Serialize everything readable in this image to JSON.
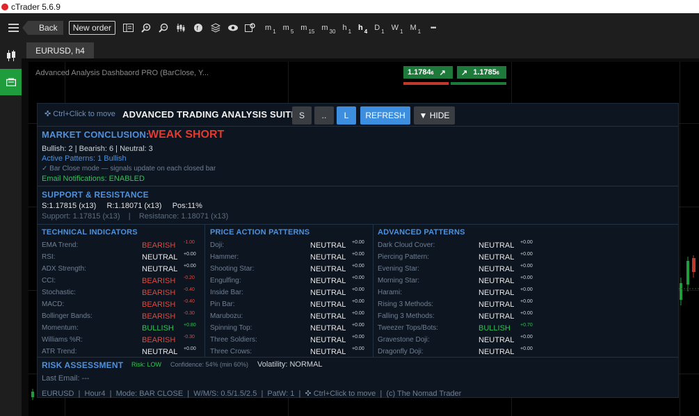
{
  "app": {
    "title": "cTrader 5.6.9"
  },
  "toolbar": {
    "back_label": "Back",
    "new_order_label": "New order",
    "icons": [
      "layout-icon",
      "zoom-in-icon",
      "zoom-out-icon",
      "chart-type-icon",
      "indicators-icon",
      "layers-icon",
      "eye-icon",
      "settings-icon"
    ],
    "timeframes": [
      {
        "l": "m",
        "s": "1"
      },
      {
        "l": "m",
        "s": "5"
      },
      {
        "l": "m",
        "s": "15"
      },
      {
        "l": "m",
        "s": "30"
      },
      {
        "l": "h",
        "s": "1"
      },
      {
        "l": "h",
        "s": "4"
      },
      {
        "l": "D",
        "s": "1"
      },
      {
        "l": "W",
        "s": "1"
      },
      {
        "l": "M",
        "s": "1"
      }
    ],
    "active_timeframe": "h4",
    "more_label": "•••"
  },
  "tab": {
    "label": "EURUSD, h4"
  },
  "chart": {
    "title": "Advanced Analysis Dashbaord PRO (BarClose, Y...",
    "sell": {
      "price": "1.1784",
      "pip": "6"
    },
    "buy": {
      "price": "1.1785",
      "pip": "6"
    }
  },
  "panel": {
    "move_hint": "✜ Ctrl+Click to move",
    "title": "ADVANCED TRADING ANALYSIS SUITE",
    "buttons": {
      "s": "S",
      "dots": "..",
      "l": "L",
      "refresh": "REFRESH",
      "hide": "▼ HIDE"
    },
    "market": {
      "title": "MARKET CONCLUSION:",
      "conclusion": "WEAK SHORT",
      "counts": "Bullish: 2  |  Bearish: 6  |  Neutral: 3",
      "patterns": "Active Patterns: 1 Bullish",
      "mode": "✓ Bar Close mode — signals update on each closed bar",
      "email": "Email Notifications: ENABLED"
    },
    "sr": {
      "title": "SUPPORT & RESISTANCE",
      "line1": "S:1.17815 (x13)     R:1.18071 (x13)     Pos:11%",
      "line2": "Support: 1.17815 (x13)    |    Resistance: 1.18071 (x13)"
    },
    "technical": {
      "title": "TECHNICAL INDICATORS",
      "rows": [
        {
          "name": "EMA Trend:",
          "status": "BEARISH",
          "score": "-1.00"
        },
        {
          "name": "RSI:",
          "status": "NEUTRAL",
          "score": "+0.00"
        },
        {
          "name": "ADX Strength:",
          "status": "NEUTRAL",
          "score": "+0.00"
        },
        {
          "name": "CCI:",
          "status": "BEARISH",
          "score": "-0.20"
        },
        {
          "name": "Stochastic:",
          "status": "BEARISH",
          "score": "-0.40"
        },
        {
          "name": "MACD:",
          "status": "BEARISH",
          "score": "-0.40"
        },
        {
          "name": "Bollinger Bands:",
          "status": "BEARISH",
          "score": "-0.30"
        },
        {
          "name": "Momentum:",
          "status": "BULLISH",
          "score": "+0.80"
        },
        {
          "name": "Williams %R:",
          "status": "BEARISH",
          "score": "-0.30"
        },
        {
          "name": "ATR Trend:",
          "status": "NEUTRAL",
          "score": "+0.00"
        }
      ]
    },
    "price_action": {
      "title": "PRICE ACTION PATTERNS",
      "rows": [
        {
          "name": "Doji:",
          "status": "NEUTRAL",
          "score": "+0.00"
        },
        {
          "name": "Hammer:",
          "status": "NEUTRAL",
          "score": "+0.00"
        },
        {
          "name": "Shooting Star:",
          "status": "NEUTRAL",
          "score": "+0.00"
        },
        {
          "name": "Engulfing:",
          "status": "NEUTRAL",
          "score": "+0.00"
        },
        {
          "name": "Inside Bar:",
          "status": "NEUTRAL",
          "score": "+0.00"
        },
        {
          "name": "Pin Bar:",
          "status": "NEUTRAL",
          "score": "+0.00"
        },
        {
          "name": "Marubozu:",
          "status": "NEUTRAL",
          "score": "+0.00"
        },
        {
          "name": "Spinning Top:",
          "status": "NEUTRAL",
          "score": "+0.00"
        },
        {
          "name": "Three Soldiers:",
          "status": "NEUTRAL",
          "score": "+0.00"
        },
        {
          "name": "Three Crows:",
          "status": "NEUTRAL",
          "score": "+0.00"
        }
      ]
    },
    "advanced": {
      "title": "ADVANCED PATTERNS",
      "rows": [
        {
          "name": "Dark Cloud Cover:",
          "status": "NEUTRAL",
          "score": "+0.00"
        },
        {
          "name": "Piercing Pattern:",
          "status": "NEUTRAL",
          "score": "+0.00"
        },
        {
          "name": "Evening Star:",
          "status": "NEUTRAL",
          "score": "+0.00"
        },
        {
          "name": "Morning Star:",
          "status": "NEUTRAL",
          "score": "+0.00"
        },
        {
          "name": "Harami:",
          "status": "NEUTRAL",
          "score": "+0.00"
        },
        {
          "name": "Rising 3 Methods:",
          "status": "NEUTRAL",
          "score": "+0.00"
        },
        {
          "name": "Falling 3 Methods:",
          "status": "NEUTRAL",
          "score": "+0.00"
        },
        {
          "name": "Tweezer Tops/Bots:",
          "status": "BULLISH",
          "score": "+0.70"
        },
        {
          "name": "Gravestone Doji:",
          "status": "NEUTRAL",
          "score": "+0.00"
        },
        {
          "name": "Dragonfly Doji:",
          "status": "NEUTRAL",
          "score": "+0.00"
        }
      ]
    },
    "risk": {
      "title": "RISK ASSESSMENT",
      "risk": "Risk: LOW",
      "confidence": "Confidence: 54% (min 60%)",
      "volatility": "Volatility: NORMAL",
      "last_email": "Last Email: ---"
    },
    "footer": "EURUSD  |  Hour4  |  Mode: BAR CLOSE  |  W/M/S: 0.5/1.5/2.5  |  PatW: 1  |  ✜ Ctrl+Click to move  |  (c) The Nomad Trader"
  },
  "colors": {
    "accent_blue": "#4f91da",
    "bearish": "#e8463b",
    "bullish": "#36c05a",
    "button_blue": "#3e8ee0",
    "app_green": "#1f9d3c"
  }
}
